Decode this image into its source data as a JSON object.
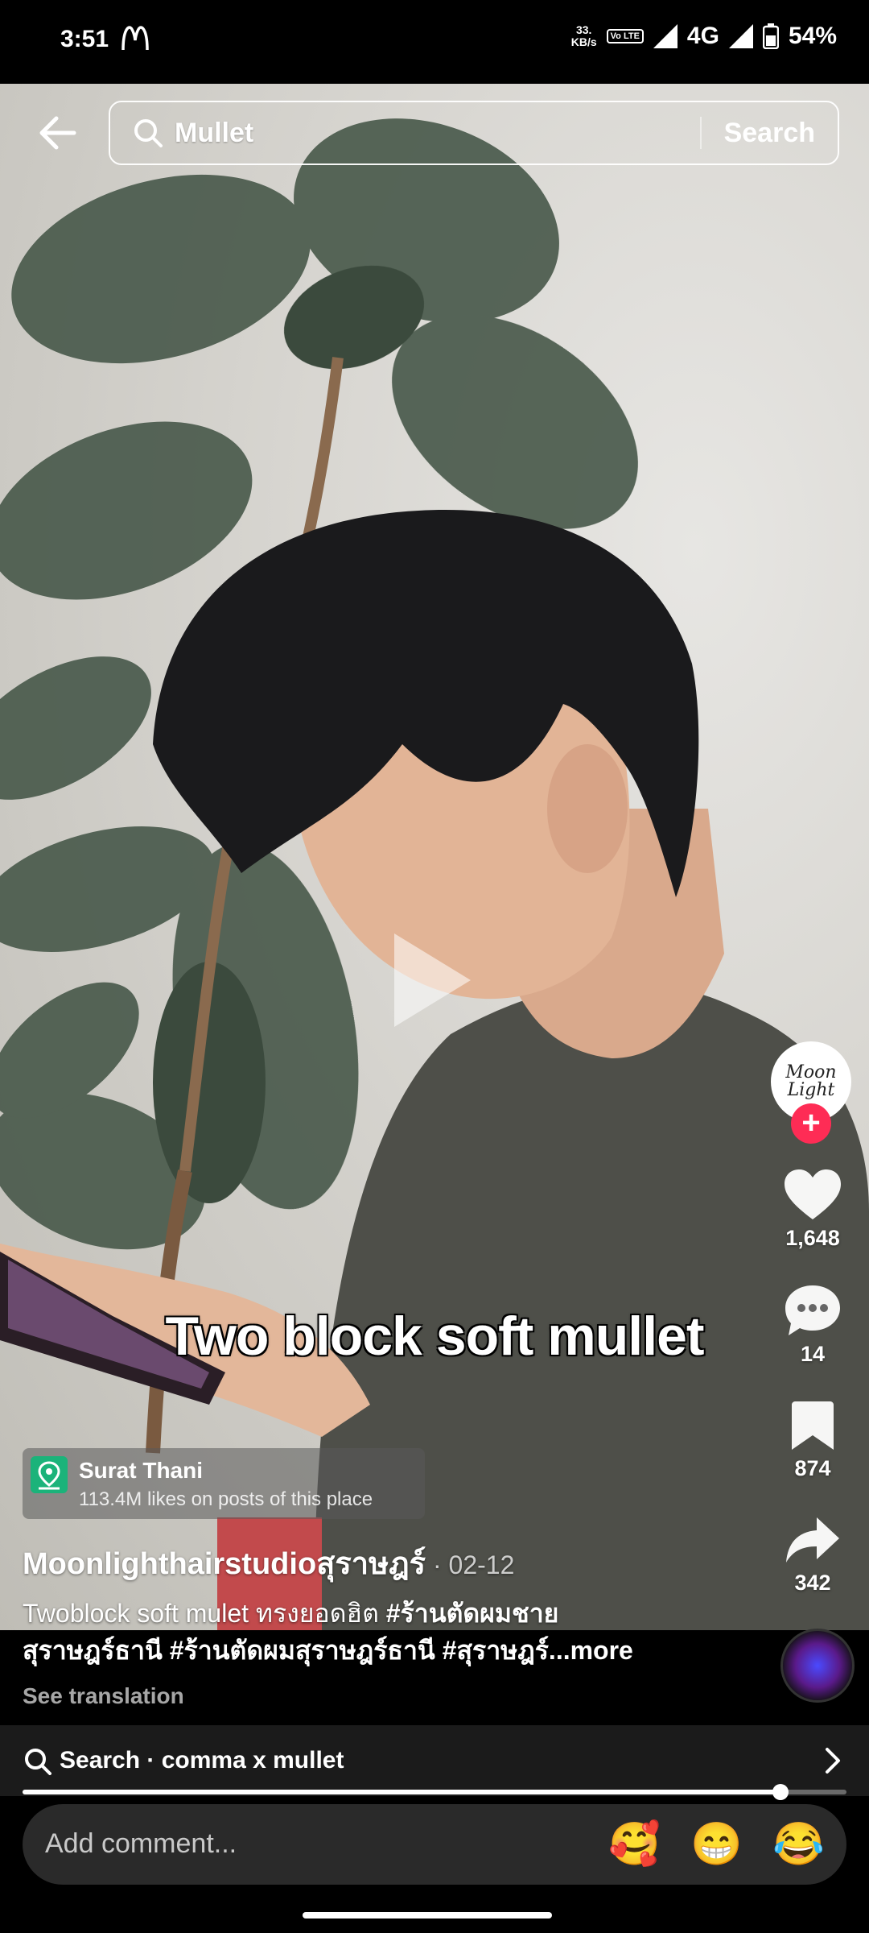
{
  "status_bar": {
    "time": "3:51",
    "speed_value": "33.",
    "speed_unit": "KB/s",
    "volte": "Vo LTE",
    "network": "4G",
    "battery": "54%"
  },
  "search": {
    "query": "Mullet",
    "button_label": "Search"
  },
  "video": {
    "overlay_caption": "Two block soft mullet"
  },
  "right_rail": {
    "avatar_text": "Moon Light",
    "follow_symbol": "+",
    "likes": "1,648",
    "comments": "14",
    "saves": "874",
    "shares": "342"
  },
  "location": {
    "name": "Surat Thani",
    "subtitle": "113.4M likes on posts of this place"
  },
  "post": {
    "author": "Moonlighthairstudioสุราษฎร์",
    "date": " · 02-12",
    "desc_plain": "Twoblock soft mulet ทรงยอดฮิต ",
    "tag1": "#ร้านตัดผมชาย",
    "tag1b": "สุราษฎร์ธานี",
    "tag2": "#ร้านตัดผมสุราษฎร์ธานี",
    "tag3": "#สุราษฎร์...",
    "more": "more",
    "see_translation": "See translation"
  },
  "related_search": {
    "label": "Search · comma x mullet"
  },
  "playback": {
    "progress": 0.92
  },
  "comment_bar": {
    "placeholder": "Add comment...",
    "emoji1": "🥰",
    "emoji2": "😁",
    "emoji3": "😂"
  },
  "colors": {
    "follow_red": "#fe2c55",
    "location_green": "#1bb37a"
  }
}
